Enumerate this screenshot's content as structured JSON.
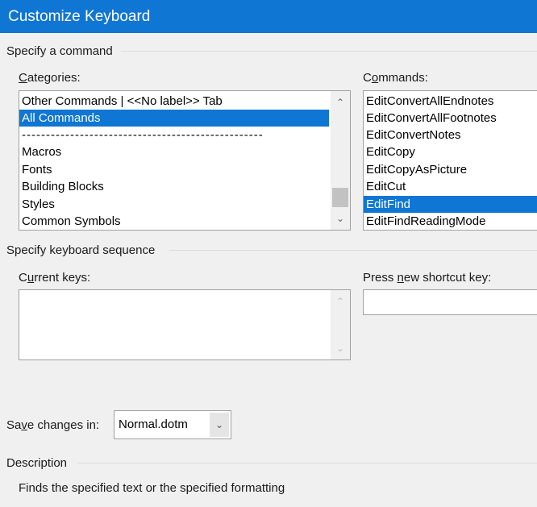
{
  "window": {
    "title": "Customize Keyboard"
  },
  "specify_command": {
    "heading": "Specify a command",
    "categories": {
      "label_prefix": "",
      "label_mnemonic": "C",
      "label_rest": "ategories:",
      "items": [
        "Other Commands | <<No label>> Tab",
        "All Commands",
        "--------------------------------------------------",
        "Macros",
        "Fonts",
        "Building Blocks",
        "Styles",
        "Common Symbols"
      ],
      "selected_index": 1
    },
    "commands": {
      "label_prefix": "C",
      "label_mnemonic": "o",
      "label_rest": "mmands:",
      "items": [
        "EditConvertAllEndnotes",
        "EditConvertAllFootnotes",
        "EditConvertNotes",
        "EditCopy",
        "EditCopyAsPicture",
        "EditCut",
        "EditFind",
        "EditFindReadingMode"
      ],
      "selected_index": 6
    }
  },
  "keyboard_sequence": {
    "heading": "Specify keyboard sequence",
    "current_keys": {
      "label_prefix": "C",
      "label_mnemonic": "u",
      "label_rest": "rrent keys:"
    },
    "new_key": {
      "label_prefix": "Press ",
      "label_mnemonic": "n",
      "label_rest": "ew shortcut key:",
      "value": ""
    }
  },
  "save_changes": {
    "label_prefix": "Sa",
    "label_mnemonic": "v",
    "label_rest": "e changes in:",
    "selected": "Normal.dotm"
  },
  "description": {
    "heading": "Description",
    "text": "Finds the specified text or the specified formatting"
  },
  "icons": {
    "up": "chevron-up-icon",
    "down": "chevron-down-icon"
  }
}
